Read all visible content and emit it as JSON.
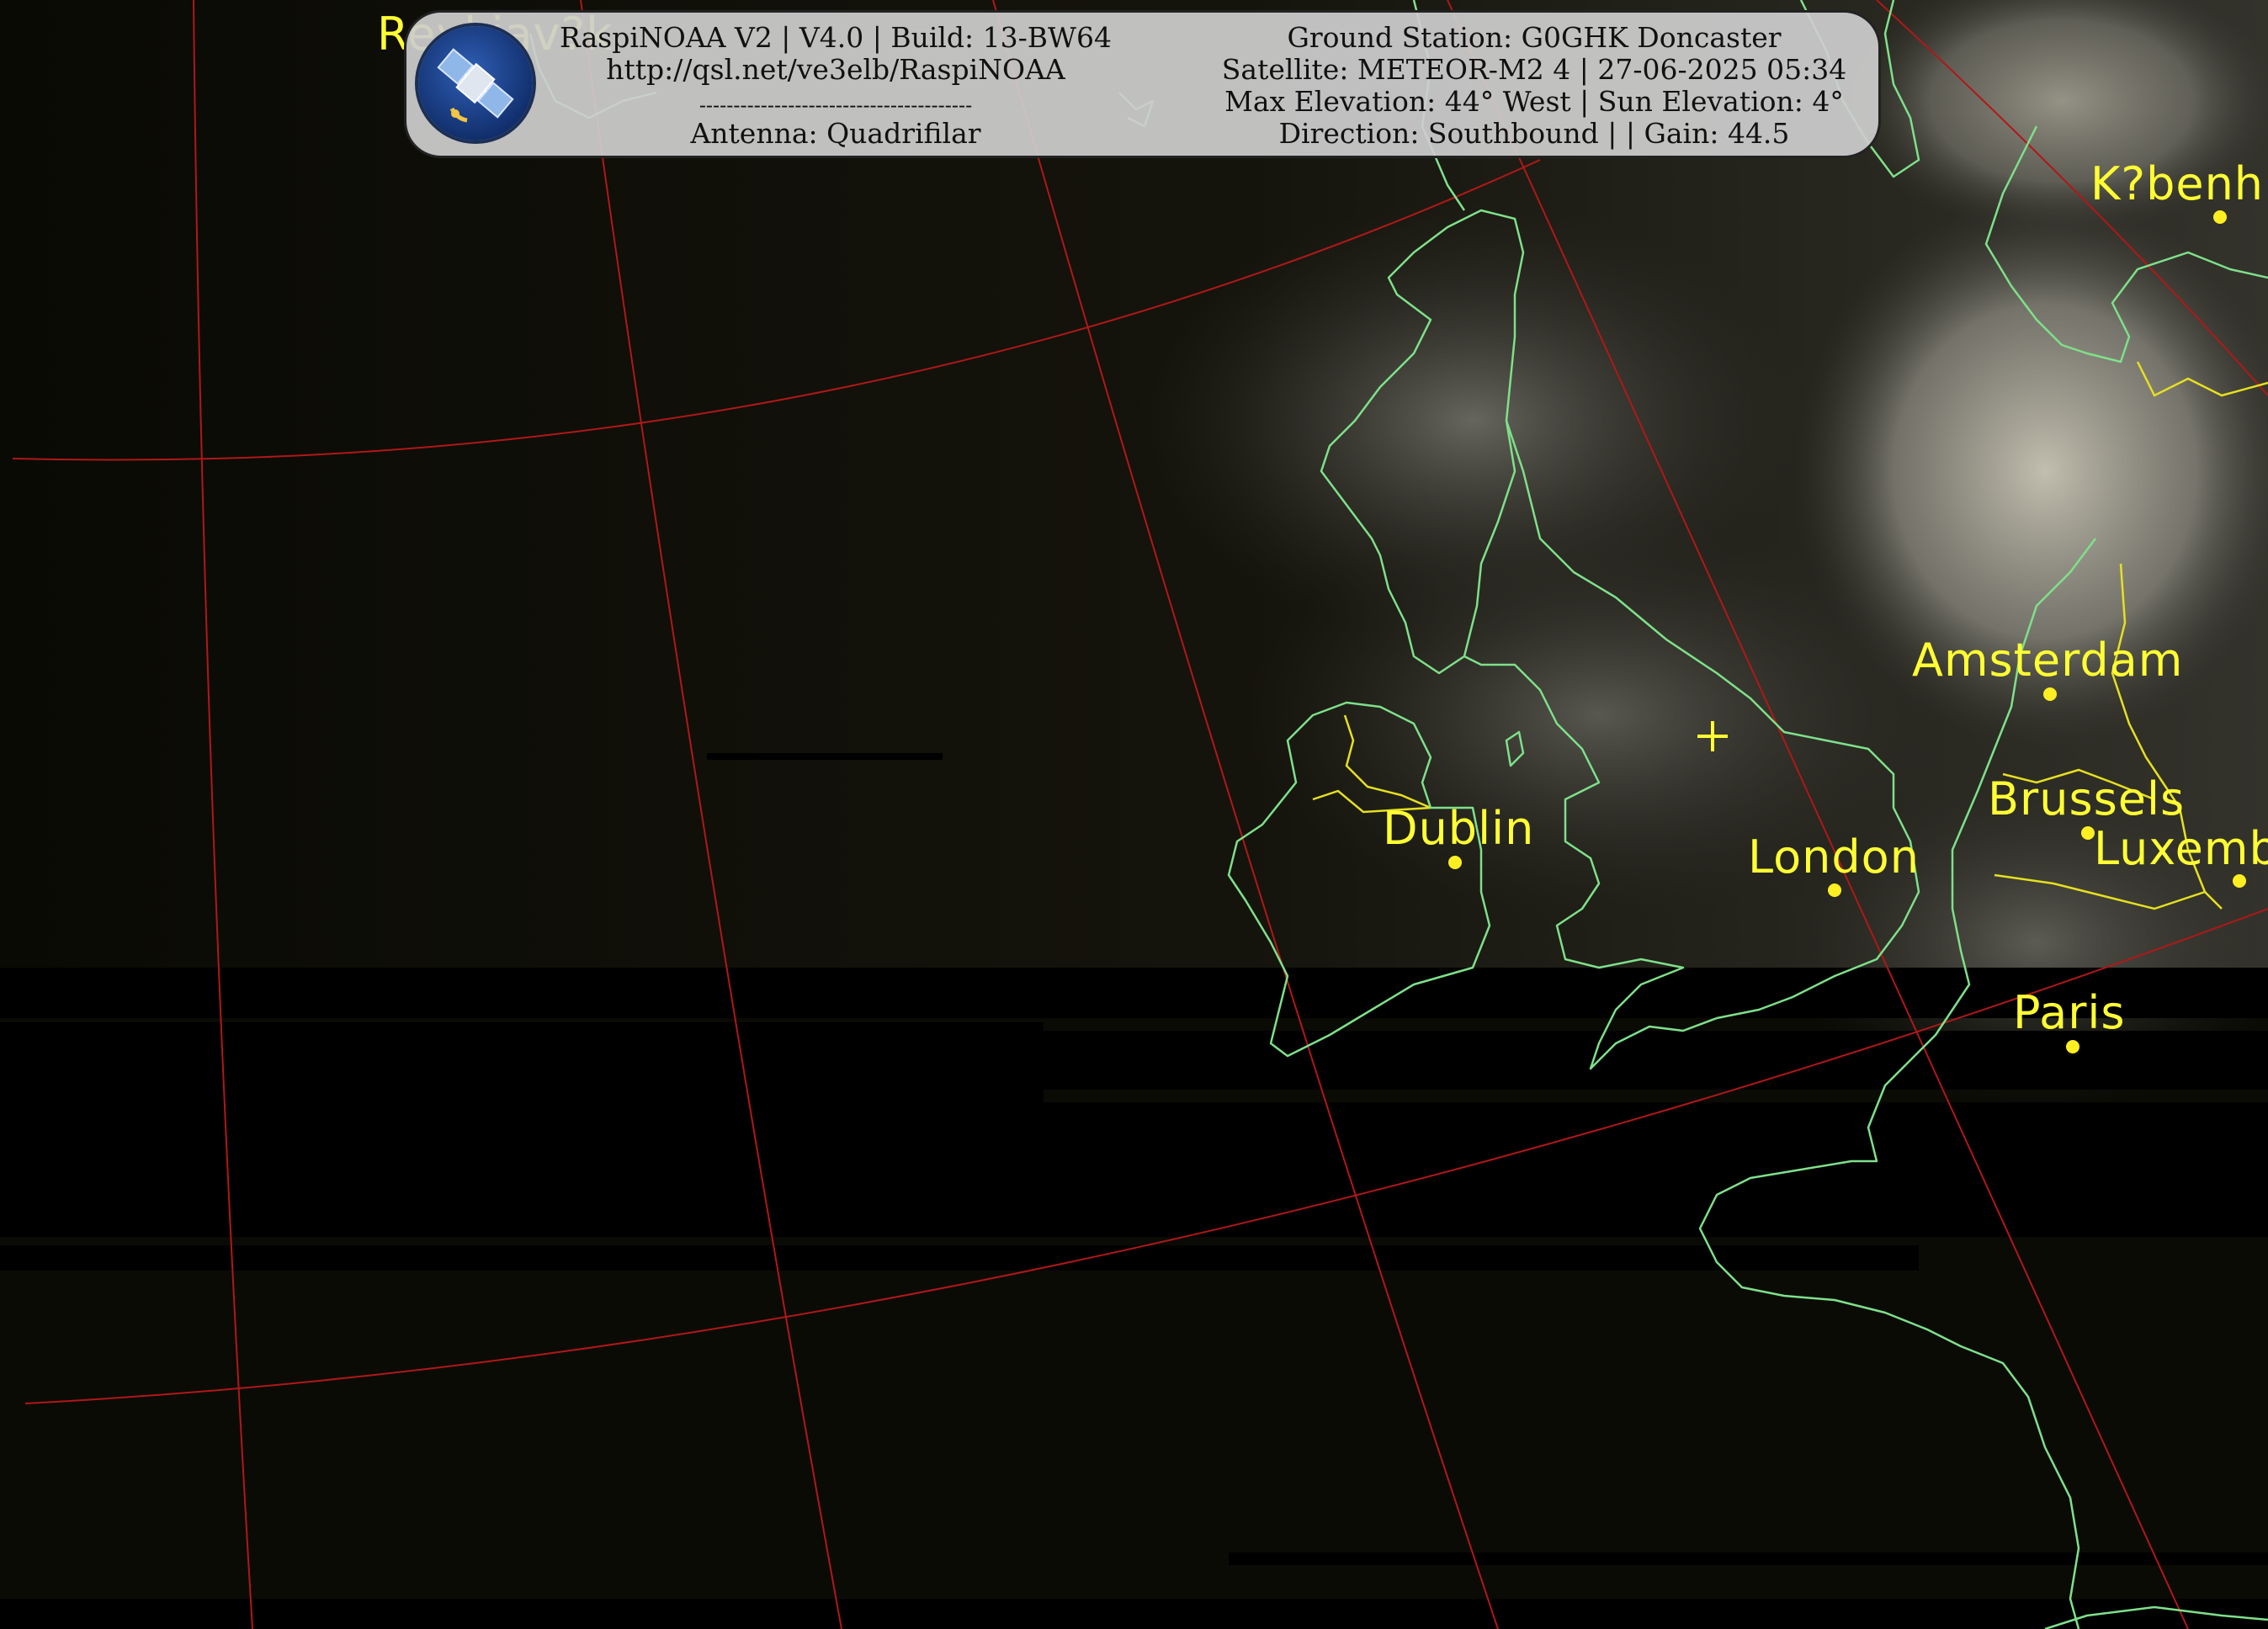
{
  "banner": {
    "left": [
      "RaspiNOAA V2 | V4.0 | Build: 13-BW64",
      "http://qsl.net/ve3elb/RaspiNOAA",
      "----------------------------------------",
      "Antenna: Quadrifilar"
    ],
    "right": [
      "Ground Station: G0GHK Doncaster",
      "Satellite: METEOR-M2 4 | 27-06-2025 05:34",
      "Max Elevation: 44° West | Sun Elevation: 4°",
      "Direction: Southbound | | Gain: 44.5"
    ]
  },
  "map": {
    "cities": [
      {
        "name": "Reykjav?k",
        "dot": false
      },
      {
        "name": "K?benh",
        "dot": true
      },
      {
        "name": "Amsterdam",
        "dot": true
      },
      {
        "name": "Brussels",
        "dot": true
      },
      {
        "name": "Luxemb",
        "dot": true
      },
      {
        "name": "Dublin",
        "dot": true
      },
      {
        "name": "London",
        "dot": true
      },
      {
        "name": "Paris",
        "dot": true
      }
    ],
    "colors": {
      "coastline": "#7fe08a",
      "border": "#e6e020",
      "graticule": "#b01818",
      "city": "#ffff33",
      "ground_station_marker": "#ffff33"
    }
  }
}
